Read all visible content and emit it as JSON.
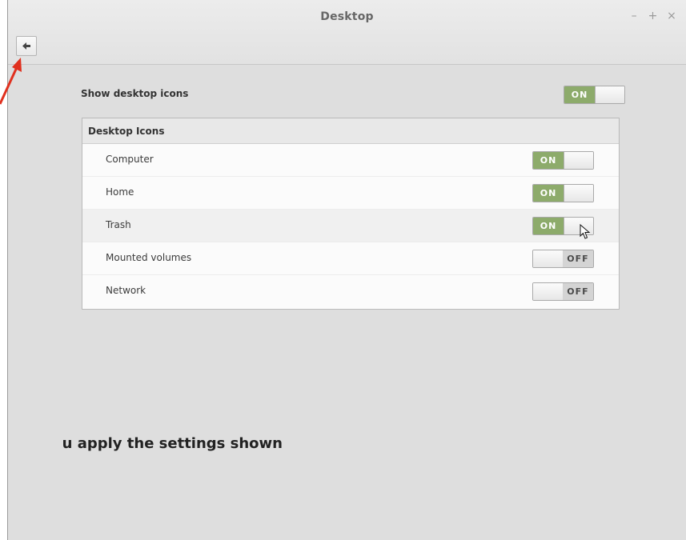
{
  "window": {
    "title": "Desktop",
    "controls": [
      "–",
      "+",
      "×"
    ]
  },
  "toolbar": {
    "back_icon": "back-arrow-icon"
  },
  "show_desktop_icons": {
    "label": "Show desktop icons",
    "state": "ON"
  },
  "panel": {
    "header": "Desktop Icons",
    "items": [
      {
        "label": "Computer",
        "state": "ON"
      },
      {
        "label": "Home",
        "state": "ON"
      },
      {
        "label": "Trash",
        "state": "ON"
      },
      {
        "label": "Mounted volumes",
        "state": "OFF"
      },
      {
        "label": "Network",
        "state": "OFF"
      }
    ]
  },
  "caption": "u apply the settings shown",
  "colors": {
    "on_green": "#8dab6b",
    "arrow_red": "#e0301e",
    "window_bg": "#dedede"
  }
}
